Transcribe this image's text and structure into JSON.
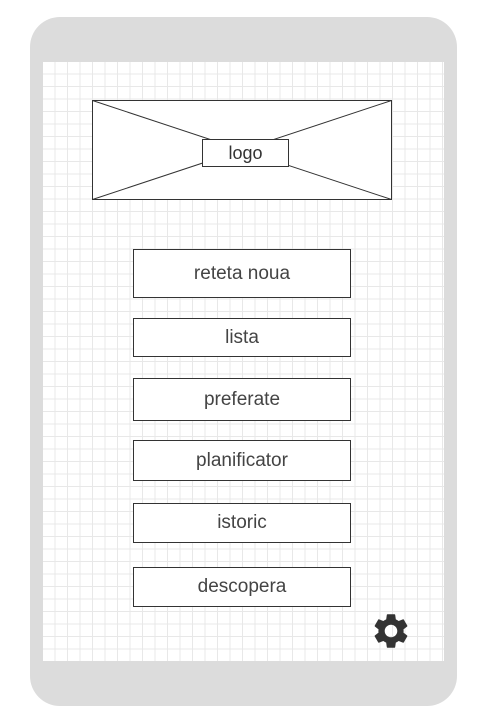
{
  "logo": {
    "label": "logo"
  },
  "menu": {
    "items": [
      {
        "label": "reteta noua"
      },
      {
        "label": "lista"
      },
      {
        "label": "preferate"
      },
      {
        "label": "planificator"
      },
      {
        "label": "istoric"
      },
      {
        "label": "descopera"
      }
    ]
  },
  "settings": {
    "icon": "gear-icon"
  },
  "colors": {
    "frame": "#dcdcdc",
    "grid": "#e8e8e8",
    "stroke": "#333333",
    "text": "#444444"
  }
}
